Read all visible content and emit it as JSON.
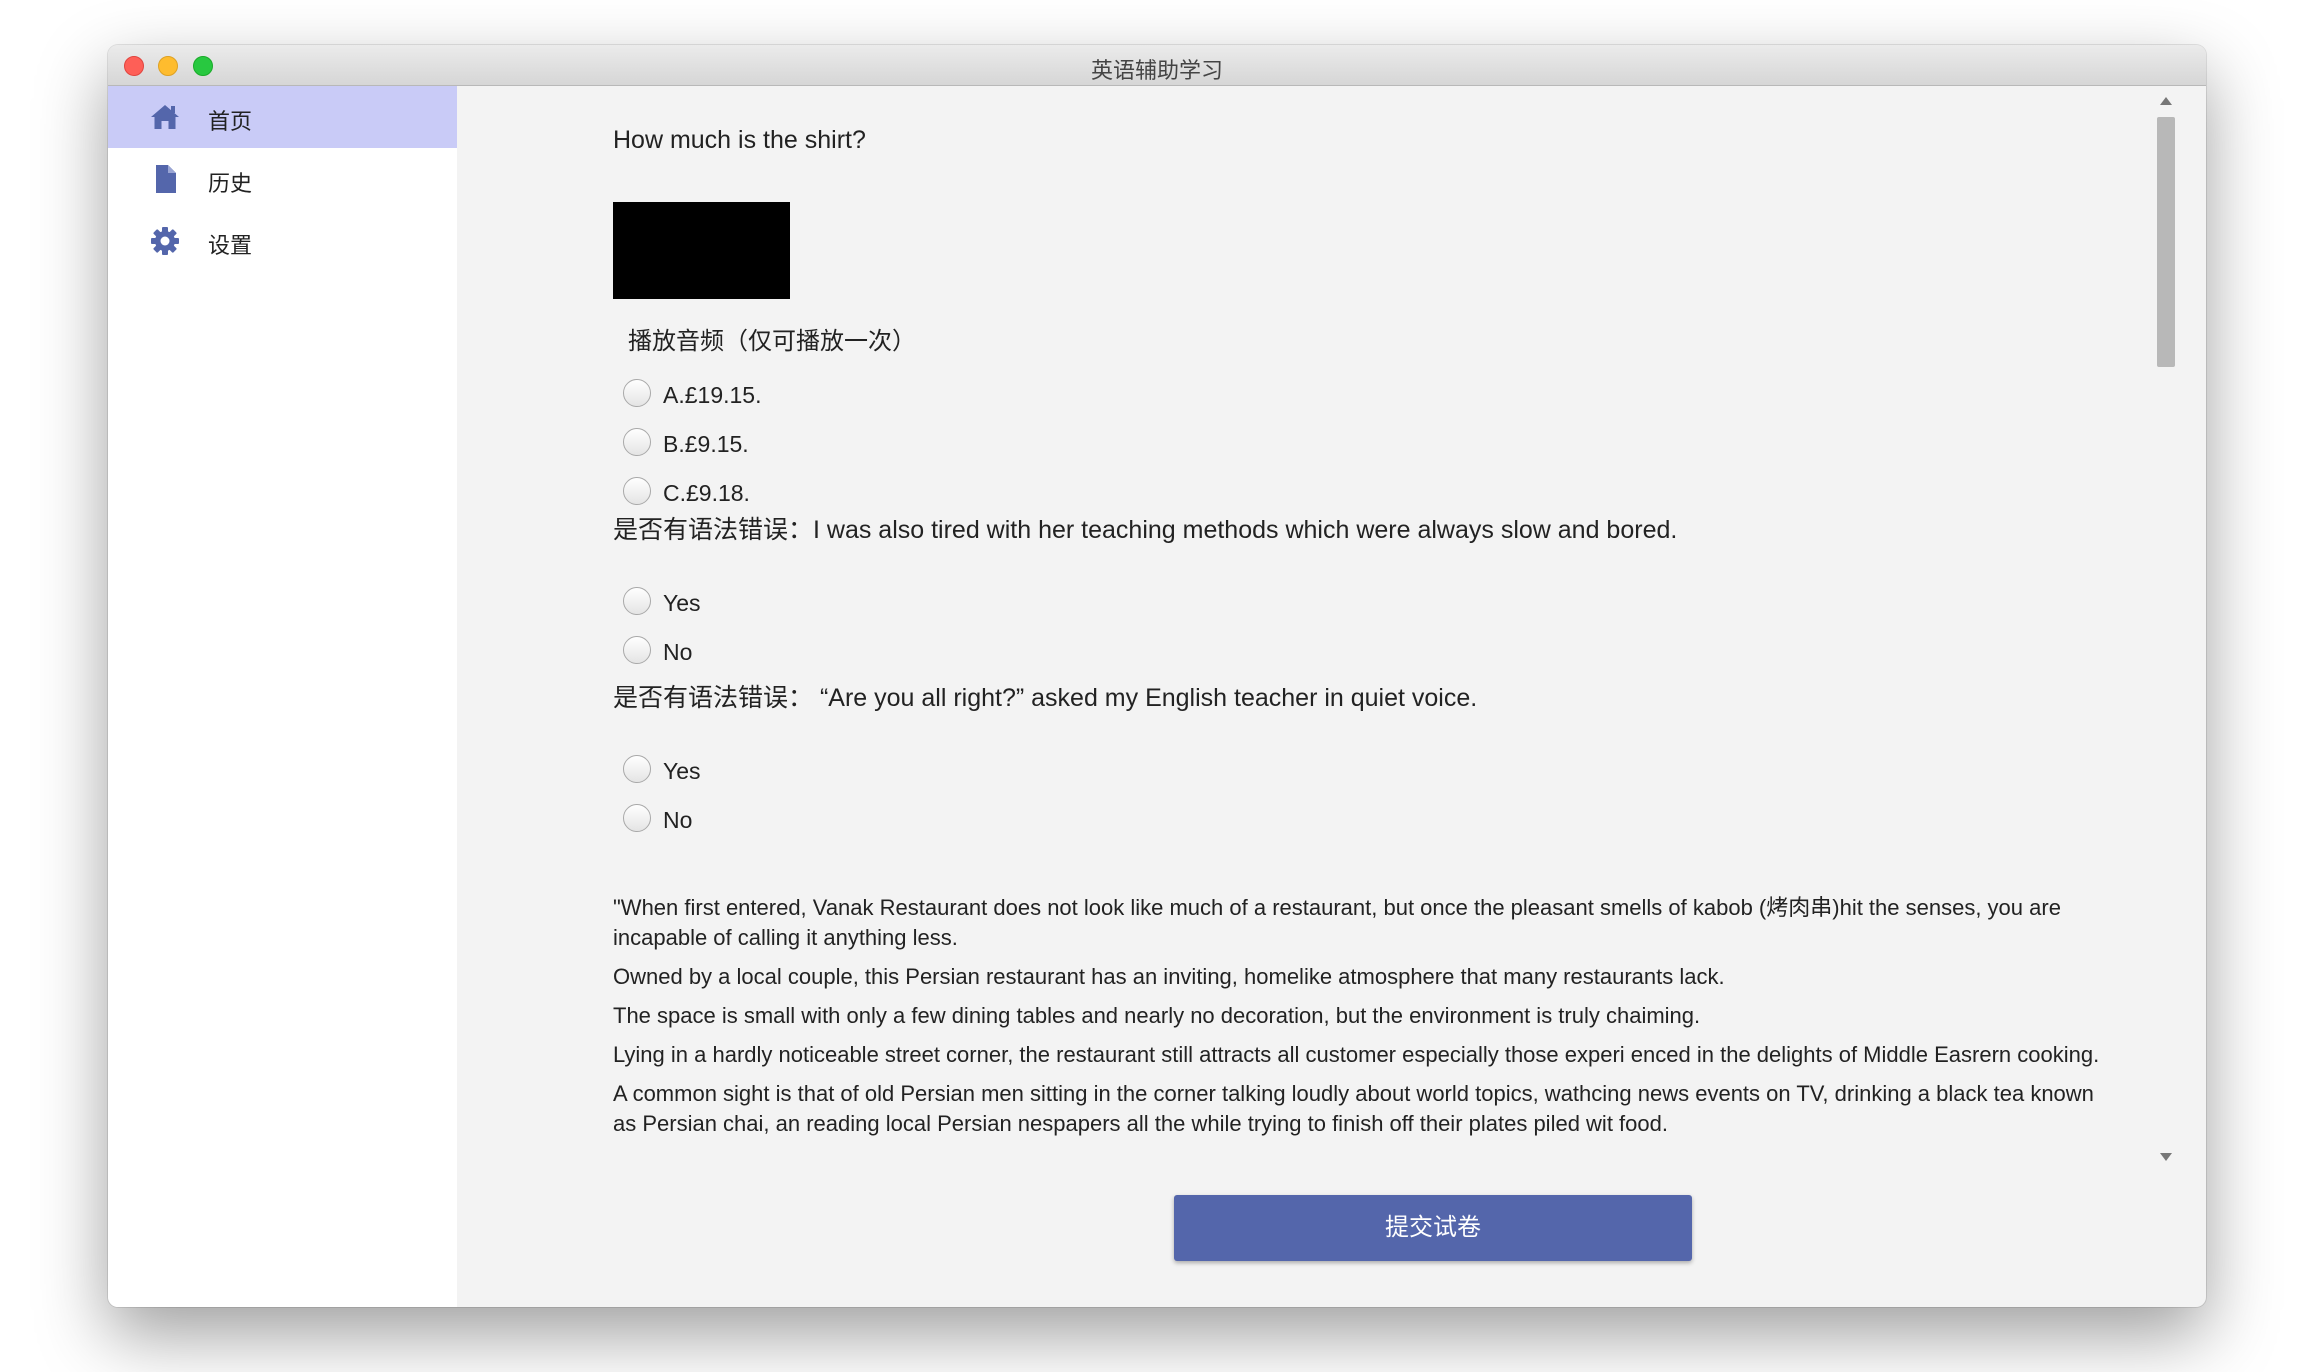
{
  "window": {
    "title": "英语辅助学习"
  },
  "sidebar": {
    "items": [
      {
        "label": "首页",
        "icon": "home-icon",
        "active": true
      },
      {
        "label": "历史",
        "icon": "document-icon",
        "active": false
      },
      {
        "label": "设置",
        "icon": "gear-icon",
        "active": false
      }
    ]
  },
  "questions": {
    "listening": {
      "prompt": "How much is the shirt?",
      "audio_caption": "播放音频（仅可播放一次）",
      "options": [
        "A.£19.15.",
        "B.£9.15.",
        "C.£9.18."
      ]
    },
    "grammar1": {
      "prompt": "是否有语法错误：I was also tired with her teaching methods which were always slow and bored.",
      "options": [
        "Yes",
        "No"
      ]
    },
    "grammar2": {
      "prompt": "是否有语法错误： “Are you all right?” asked my English teacher in quiet voice.",
      "options": [
        "Yes",
        "No"
      ]
    }
  },
  "passage": {
    "paragraphs": [
      "\"When first entered, Vanak Restaurant does not look like much of a restaurant, but once the pleasant smells of kabob (烤肉串)hit the senses, you are incapable of calling it anything less.",
      "Owned by a local couple, this Persian restaurant has an inviting, homelike atmosphere that many restaurants lack.",
      "The space is small with only a few dining tables and nearly no decoration, but the environment is truly chaiming.",
      "Lying in a hardly noticeable street corner, the restaurant still attracts all customer especially those experi enced in the delights of Middle Easrern cooking.",
      "A common sight is that of old Persian men sitting in the corner talking loudly about world topics, wathcing news events on TV, drinking a black tea known as Persian chai, an reading local Persian nespapers all the while trying to finish off their plates piled wit food."
    ]
  },
  "submit": {
    "label": "提交试卷"
  },
  "colors": {
    "accent": "#5466ab",
    "sidebar_active": "#c9cbf7",
    "icon": "#5466ab"
  }
}
